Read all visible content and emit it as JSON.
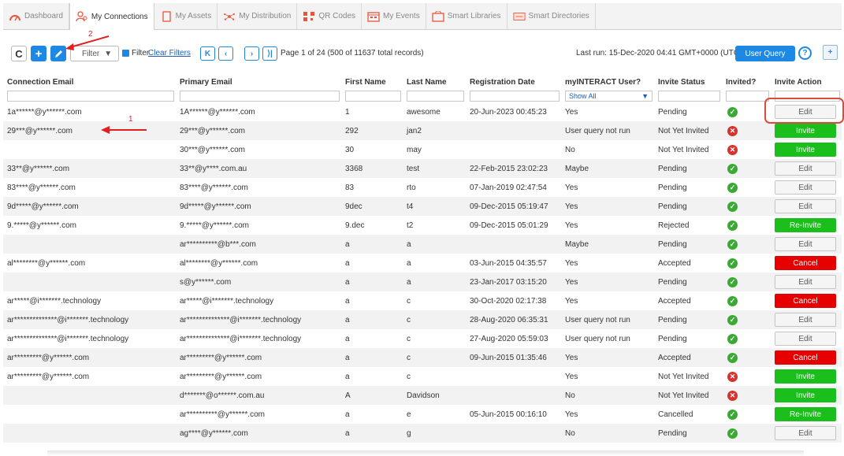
{
  "tabs": [
    {
      "label": "Dashboard",
      "icon": "dashboard-icon",
      "active": false
    },
    {
      "label": "My Connections",
      "icon": "connections-icon",
      "active": true
    },
    {
      "label": "My Assets",
      "icon": "assets-icon",
      "active": false
    },
    {
      "label": "My Distribution",
      "icon": "distribution-icon",
      "active": false
    },
    {
      "label": "QR Codes",
      "icon": "qr-icon",
      "active": false
    },
    {
      "label": "My Events",
      "icon": "events-icon",
      "active": false
    },
    {
      "label": "Smart Libraries",
      "icon": "library-icon",
      "active": false
    },
    {
      "label": "Smart Directories",
      "icon": "directory-icon",
      "active": false
    }
  ],
  "toolbar": {
    "filter_select": "Filter",
    "filter_label": "Filter",
    "clear_filters": "Clear Filters",
    "page_info": "Page 1 of 24 (500 of 11637 total records)",
    "last_run": "Last run: 15-Dec-2020 04:41 GMT+0000 (UTC)",
    "user_query": "User Query",
    "help": "?"
  },
  "columns": [
    "Connection Email",
    "Primary Email",
    "First Name",
    "Last Name",
    "Registration Date",
    "myINTERACT User?",
    "Invite Status",
    "Invited?",
    "Invite Action"
  ],
  "filter_row": {
    "myinteract_select": "Show All"
  },
  "rows": [
    {
      "conn": "1a******@y******.com",
      "primary": "1A******@y******.com",
      "first": "1",
      "last": "awesome",
      "reg": "20-Jun-2023 00:45:23",
      "user": "Yes",
      "status": "Pending",
      "invited": "ok",
      "action": "Edit"
    },
    {
      "conn": "29***@y******.com",
      "primary": "29***@y******.com",
      "first": "292",
      "last": "jan2",
      "reg": "",
      "user": "User query not run",
      "status": "Not Yet Invited",
      "invited": "x",
      "action": "Invite"
    },
    {
      "conn": "",
      "primary": "30***@y******.com",
      "first": "30",
      "last": "may",
      "reg": "",
      "user": "No",
      "status": "Not Yet Invited",
      "invited": "x",
      "action": "Invite"
    },
    {
      "conn": "33**@y******.com",
      "primary": "33**@y****.com.au",
      "first": "3368",
      "last": "test",
      "reg": "22-Feb-2015 23:02:23",
      "user": "Maybe",
      "status": "Pending",
      "invited": "ok",
      "action": "Edit"
    },
    {
      "conn": "83****@y******.com",
      "primary": "83****@y******.com",
      "first": "83",
      "last": "rto",
      "reg": "07-Jan-2019 02:47:54",
      "user": "Yes",
      "status": "Pending",
      "invited": "ok",
      "action": "Edit"
    },
    {
      "conn": "9d*****@y******.com",
      "primary": "9d*****@y******.com",
      "first": "9dec",
      "last": "t4",
      "reg": "09-Dec-2015 05:19:47",
      "user": "Yes",
      "status": "Pending",
      "invited": "ok",
      "action": "Edit"
    },
    {
      "conn": "9.*****@y******.com",
      "primary": "9.*****@y******.com",
      "first": "9.dec",
      "last": "t2",
      "reg": "09-Dec-2015 05:01:29",
      "user": "Yes",
      "status": "Rejected",
      "invited": "ok",
      "action": "Re-Invite"
    },
    {
      "conn": "",
      "primary": "ar**********@b***.com",
      "first": "a",
      "last": "a",
      "reg": "",
      "user": "Maybe",
      "status": "Pending",
      "invited": "ok",
      "action": "Edit"
    },
    {
      "conn": "al********@y******.com",
      "primary": "al********@y******.com",
      "first": "a",
      "last": "a",
      "reg": "03-Jun-2015 04:35:57",
      "user": "Yes",
      "status": "Accepted",
      "invited": "ok",
      "action": "Cancel"
    },
    {
      "conn": "",
      "primary": "s@y******.com",
      "first": "a",
      "last": "a",
      "reg": "23-Jan-2017 03:15:20",
      "user": "Yes",
      "status": "Pending",
      "invited": "ok",
      "action": "Edit"
    },
    {
      "conn": "ar*****@i*******.technology",
      "primary": "ar*****@i*******.technology",
      "first": "a",
      "last": "c",
      "reg": "30-Oct-2020 02:17:38",
      "user": "Yes",
      "status": "Accepted",
      "invited": "ok",
      "action": "Cancel"
    },
    {
      "conn": "ar**************@i*******.technology",
      "primary": "ar**************@i*******.technology",
      "first": "a",
      "last": "c",
      "reg": "28-Aug-2020 06:35:31",
      "user": "User query not run",
      "status": "Pending",
      "invited": "ok",
      "action": "Edit"
    },
    {
      "conn": "ar**************@i*******.technology",
      "primary": "ar**************@i*******.technology",
      "first": "a",
      "last": "c",
      "reg": "27-Aug-2020 05:59:03",
      "user": "User query not run",
      "status": "Pending",
      "invited": "ok",
      "action": "Edit"
    },
    {
      "conn": "ar*********@y******.com",
      "primary": "ar*********@y******.com",
      "first": "a",
      "last": "c",
      "reg": "09-Jun-2015 01:35:46",
      "user": "Yes",
      "status": "Accepted",
      "invited": "ok",
      "action": "Cancel"
    },
    {
      "conn": "ar*********@y******.com",
      "primary": "ar*********@y******.com",
      "first": "a",
      "last": "c",
      "reg": "",
      "user": "Yes",
      "status": "Not Yet Invited",
      "invited": "x",
      "action": "Invite"
    },
    {
      "conn": "",
      "primary": "d*******@o******.com.au",
      "first": "A",
      "last": "Davidson",
      "reg": "",
      "user": "No",
      "status": "Not Yet Invited",
      "invited": "x",
      "action": "Invite"
    },
    {
      "conn": "",
      "primary": "ar**********@y******.com",
      "first": "a",
      "last": "e",
      "reg": "05-Jun-2015 00:16:10",
      "user": "Yes",
      "status": "Cancelled",
      "invited": "ok",
      "action": "Re-Invite"
    },
    {
      "conn": "",
      "primary": "ag****@y******.com",
      "first": "a",
      "last": "g",
      "reg": "",
      "user": "No",
      "status": "Pending",
      "invited": "ok",
      "action": "Edit"
    }
  ],
  "annotations": {
    "step1": "1",
    "step2": "2"
  },
  "colors": {
    "primary": "#1e88e5",
    "invite": "#1bbf1b",
    "cancel": "#e60000",
    "ok": "#3aaa35",
    "x": "#d9312b",
    "annotation": "#d94c3b"
  }
}
